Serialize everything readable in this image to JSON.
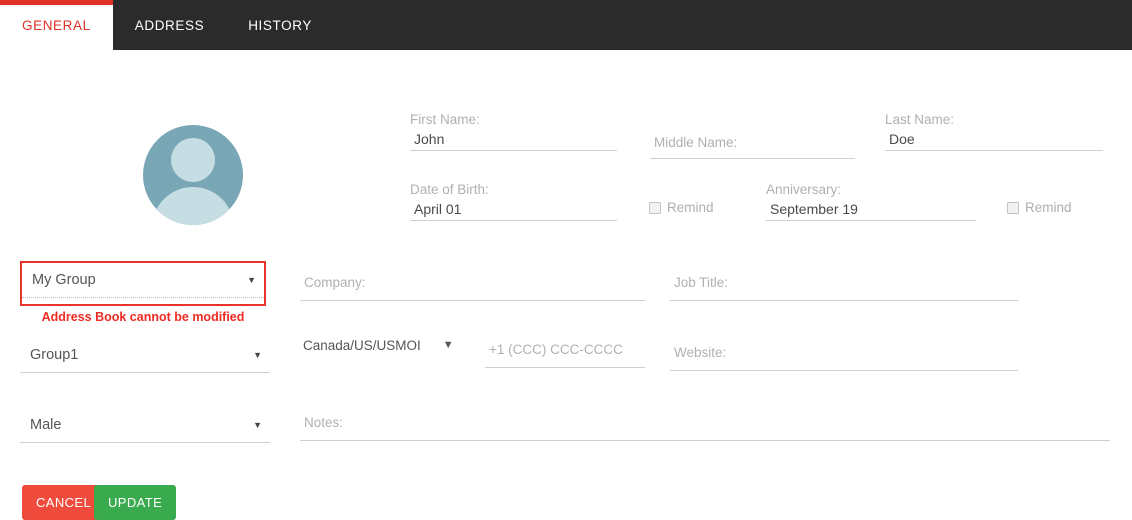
{
  "tabs": [
    {
      "label": "GENERAL",
      "active": true
    },
    {
      "label": "ADDRESS",
      "active": false
    },
    {
      "label": "HISTORY",
      "active": false
    }
  ],
  "avatar": {
    "name": "contact-avatar",
    "ring_color": "#7aa7b6",
    "figure_color": "#c6dde3"
  },
  "fields": {
    "first_name": {
      "label": "First Name:",
      "value": "John"
    },
    "middle_name": {
      "label": "Middle Name:",
      "value": ""
    },
    "last_name": {
      "label": "Last Name:",
      "value": "Doe"
    },
    "date_of_birth": {
      "label": "Date of Birth:",
      "value": "April 01"
    },
    "anniversary": {
      "label": "Anniversary:",
      "value": "September 19"
    },
    "company": {
      "label": "Company:",
      "value": ""
    },
    "job_title": {
      "label": "Job Title:",
      "value": ""
    },
    "website": {
      "label": "Website:",
      "value": ""
    },
    "notes": {
      "label": "Notes:",
      "value": ""
    },
    "phone": {
      "placeholder": "+1 (CCC) CCC-CCCC",
      "value": ""
    }
  },
  "checkboxes": {
    "dob_remind": {
      "label": "Remind",
      "checked": false
    },
    "anniversary_remind": {
      "label": "Remind",
      "checked": false
    }
  },
  "selects": {
    "address_book": {
      "value": "My Group",
      "caret": "▼",
      "error": true
    },
    "group": {
      "value": "Group1",
      "caret": "▼"
    },
    "gender": {
      "value": "Male",
      "caret": "▼"
    },
    "country": {
      "value": "Canada/US/USMOI",
      "caret": "▼"
    }
  },
  "messages": {
    "address_book_error": "Address Book cannot be modified"
  },
  "buttons": {
    "cancel": "CANCEL",
    "update": "UPDATE"
  },
  "colors": {
    "header_bg": "#2b2b2b",
    "accent_red": "#e03127",
    "error_red": "#ee2b22",
    "cancel_red": "#ef4b3c",
    "update_green": "#3aaa4f"
  }
}
